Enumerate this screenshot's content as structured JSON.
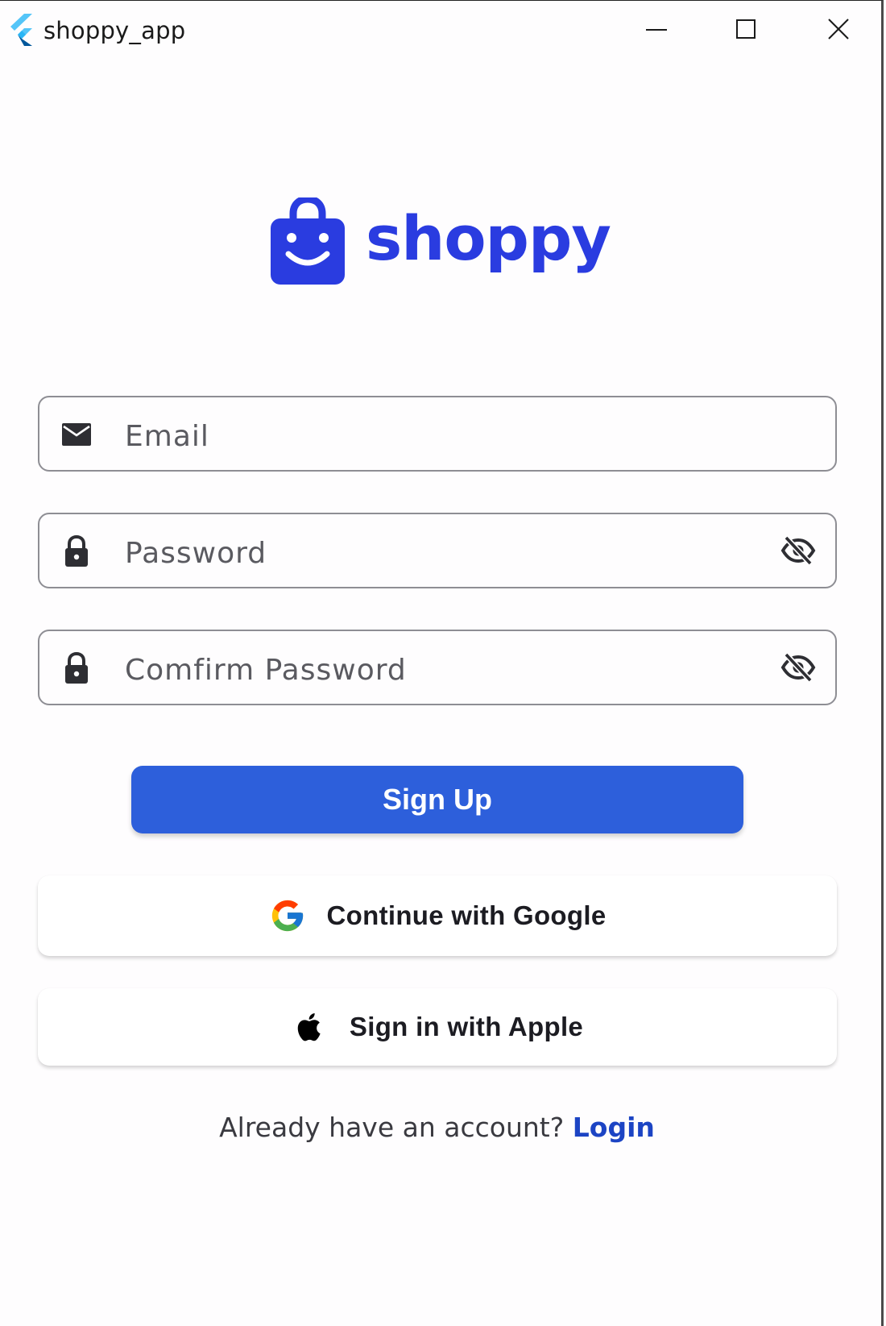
{
  "window": {
    "title": "shoppy_app"
  },
  "logo": {
    "text": "shoppy"
  },
  "form": {
    "email": {
      "placeholder": "Email",
      "value": ""
    },
    "password": {
      "placeholder": "Password",
      "value": ""
    },
    "confirm_password": {
      "placeholder": "Comfirm Password",
      "value": ""
    }
  },
  "buttons": {
    "signup_label": "Sign Up",
    "google_label": "Continue with Google",
    "apple_label": "Sign in with Apple"
  },
  "footer": {
    "prompt": "Already have an account?",
    "login_label": "Login"
  },
  "icons": {
    "app": "flutter-icon",
    "email": "mail-icon",
    "password": "lock-icon",
    "visibility": "visibility-off-icon",
    "google": "google-icon",
    "apple": "apple-icon"
  },
  "colors": {
    "brand": "#2a3ce0",
    "primary_button": "#2d5fdb",
    "link": "#1c44c4"
  }
}
